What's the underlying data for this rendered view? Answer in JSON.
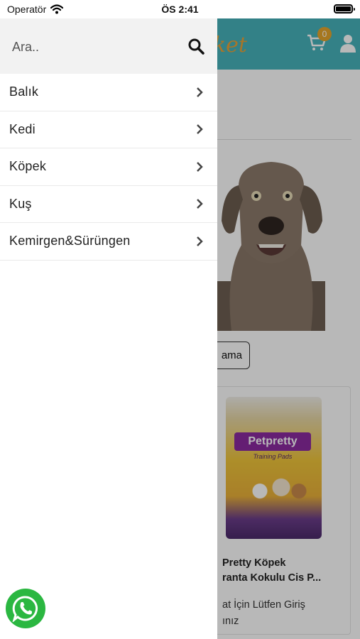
{
  "status_bar": {
    "carrier": "Operatör",
    "time": "ÖS 2:41"
  },
  "background": {
    "logo_text": "ket",
    "cart_count": "0",
    "button_label": "ama",
    "product_brand": "Petpretty",
    "product_subtitle": "Training Pads",
    "product_title": "Pretty Köpek\nranta Kokulu Cis P...",
    "product_message": "at İçin Lütfen Giriş\nınız"
  },
  "drawer": {
    "search_placeholder": "Ara..",
    "menu": [
      {
        "label": "Balık"
      },
      {
        "label": "Kedi"
      },
      {
        "label": "Köpek"
      },
      {
        "label": "Kuş"
      },
      {
        "label": "Kemirgen&Sürüngen"
      }
    ]
  },
  "colors": {
    "header": "#47b3bb",
    "badge": "#e6a52b",
    "whatsapp": "#2bb741"
  }
}
